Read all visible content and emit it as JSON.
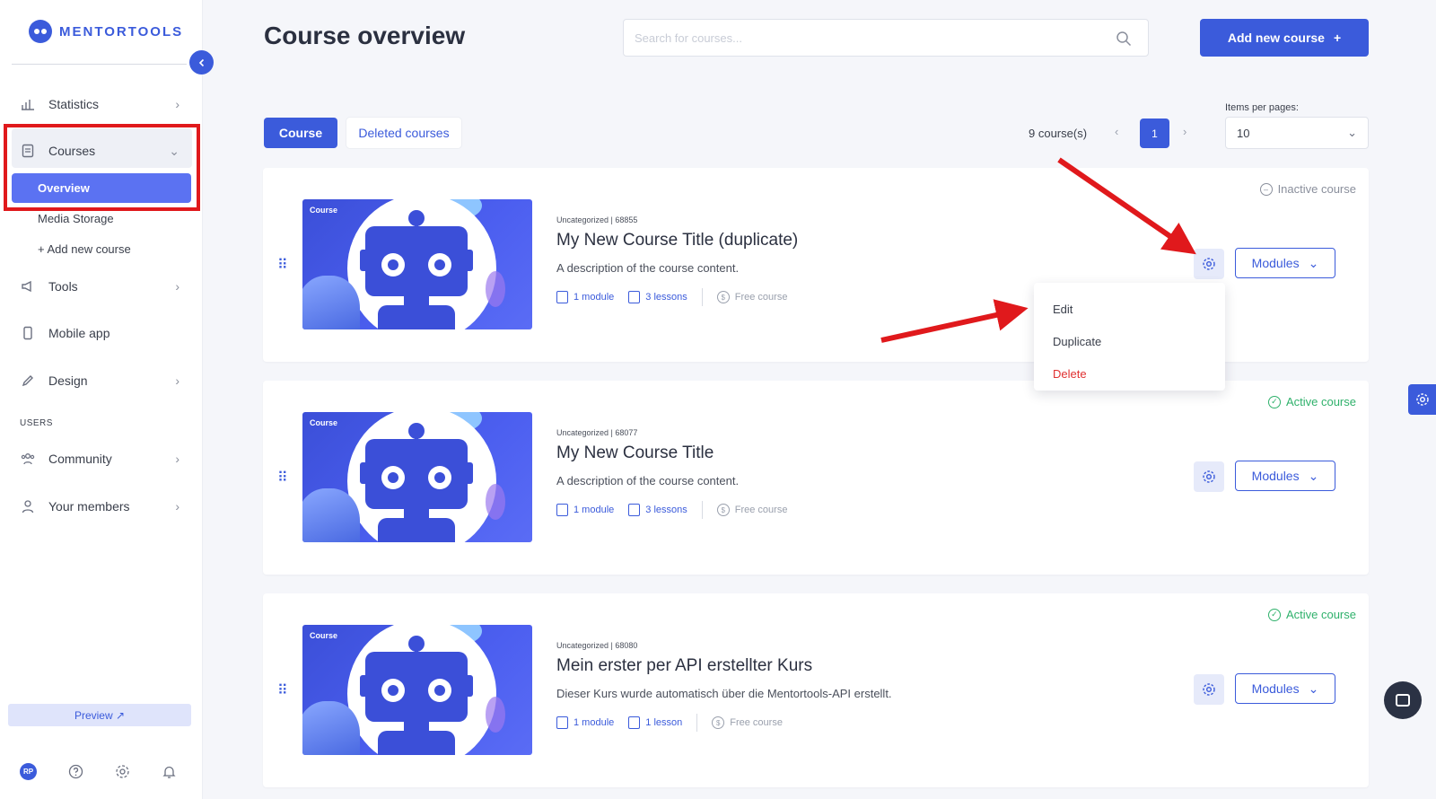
{
  "brand": {
    "name": "MENTORTOOLS"
  },
  "sidebar": {
    "items": [
      {
        "key": "statistics",
        "label": "Statistics"
      },
      {
        "key": "courses",
        "label": "Courses"
      },
      {
        "key": "tools",
        "label": "Tools"
      },
      {
        "key": "mobile_app",
        "label": "Mobile app"
      },
      {
        "key": "design",
        "label": "Design"
      },
      {
        "key": "community",
        "label": "Community"
      },
      {
        "key": "members",
        "label": "Your members"
      }
    ],
    "courses_sub": {
      "overview": "Overview",
      "media_storage": "Media Storage",
      "add_new": "+ Add new course"
    },
    "users_section": "USERS",
    "preview": "Preview ↗",
    "avatar_initials": "RP"
  },
  "header": {
    "title": "Course overview",
    "search_placeholder": "Search for courses...",
    "add_button": "Add new course"
  },
  "toolbar": {
    "tab_course": "Course",
    "tab_deleted": "Deleted courses",
    "count": "9 course(s)",
    "current_page": "1",
    "items_per_page_label": "Items per pages:",
    "items_per_page_value": "10"
  },
  "courses": [
    {
      "badge": "Course",
      "category": "Uncategorized | 68855",
      "title": "My New Course Title (duplicate)",
      "description": "A description of the course content.",
      "modules": "1 module",
      "lessons": "3 lessons",
      "price": "Free course",
      "status": "Inactive course",
      "modules_button": "Modules"
    },
    {
      "badge": "Course",
      "category": "Uncategorized | 68077",
      "title": "My New Course Title",
      "description": "A description of the course content.",
      "modules": "1 module",
      "lessons": "3 lessons",
      "price": "Free course",
      "status": "Active course",
      "modules_button": "Modules"
    },
    {
      "badge": "Course",
      "category": "Uncategorized | 68080",
      "title": "Mein erster per API erstellter Kurs",
      "description": "Dieser Kurs wurde automatisch über die Mentortools-API erstellt.",
      "modules": "1 module",
      "lessons": "1 lesson",
      "price": "Free course",
      "status": "Active course",
      "modules_button": "Modules"
    }
  ],
  "context_menu": {
    "edit": "Edit",
    "duplicate": "Duplicate",
    "delete": "Delete"
  },
  "colors": {
    "accent": "#3b5bdb",
    "active": "#2fb16b",
    "danger": "#e03131",
    "highlight": "#e0191c"
  }
}
